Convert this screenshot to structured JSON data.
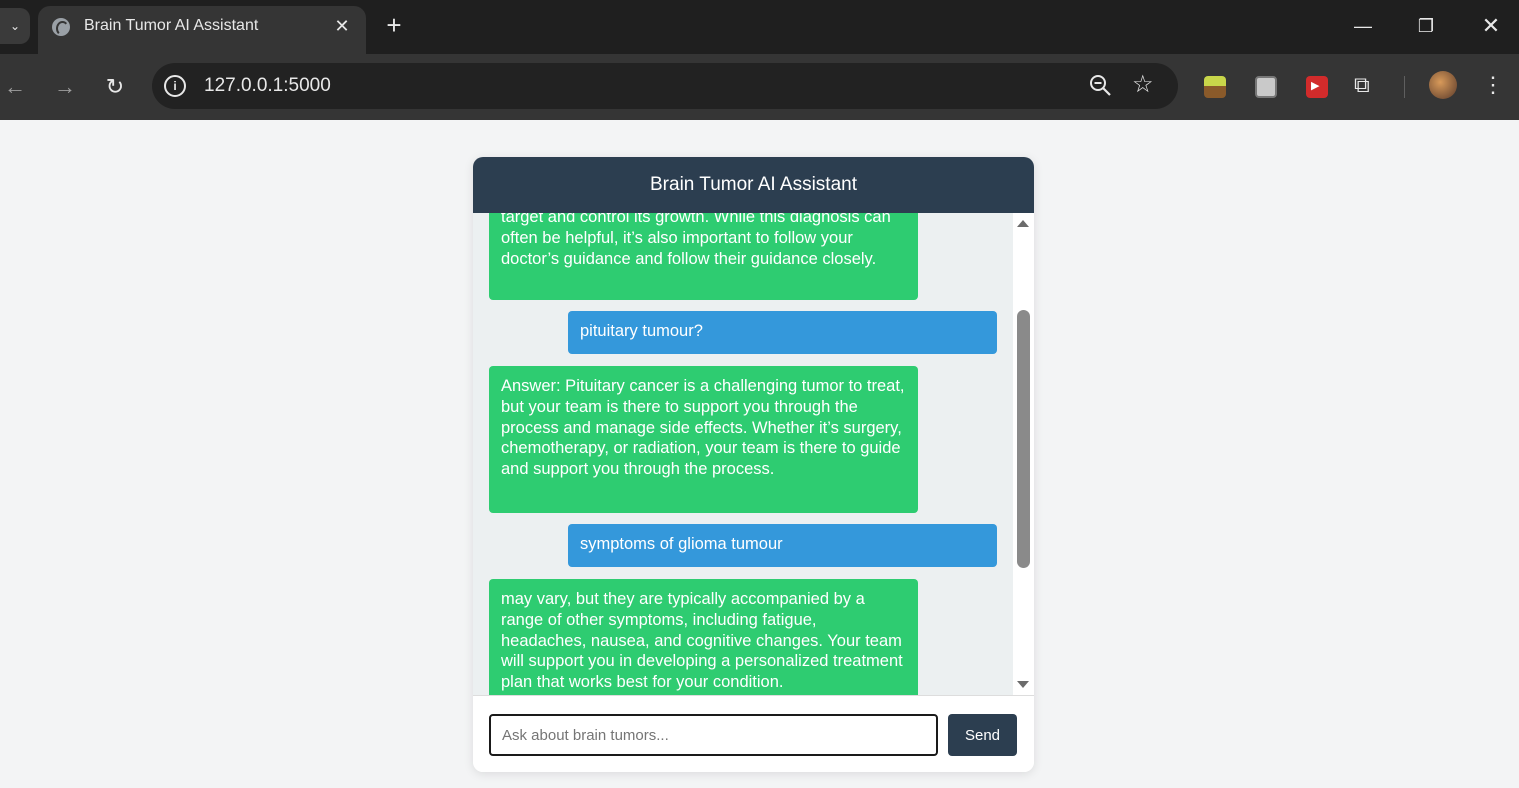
{
  "browser": {
    "tab_title": "Brain Tumor AI Assistant",
    "url": "127.0.0.1:5000",
    "icons": [
      "tab-search-icon",
      "globe-icon",
      "close-icon",
      "plus-icon",
      "minimize-icon",
      "restore-icon",
      "window-close-icon",
      "back-icon",
      "forward-icon",
      "reload-icon",
      "info-icon",
      "zoom-icon",
      "star-icon",
      "extension-icon",
      "puzzle-icon",
      "avatar",
      "kebab-menu-icon"
    ]
  },
  "chat": {
    "header_title": "Brain Tumor AI Assistant",
    "messages": [
      {
        "role": "bot",
        "text": "target and control its growth. While this diagnosis can often be helpful, it’s also important to follow your doctor’s guidance and follow their guidance closely."
      },
      {
        "role": "user",
        "text": "pituitary tumour?"
      },
      {
        "role": "bot",
        "text": "Answer: Pituitary cancer is a challenging tumor to treat, but your team is there to support you through the process and manage side effects. Whether it’s surgery, chemotherapy, or radiation, your team is there to guide and support you through the process."
      },
      {
        "role": "user",
        "text": "symptoms of glioma tumour"
      },
      {
        "role": "bot",
        "text": "may vary, but they are typically accompanied by a range of other symptoms, including fatigue, headaches, nausea, and cognitive changes. Your team will support you in developing a personalized treatment plan that works best for your condition."
      }
    ],
    "input_placeholder": "Ask about brain tumors...",
    "input_value": "",
    "send_label": "Send"
  },
  "colors": {
    "header": "#2c3e50",
    "bot_bubble": "#2ecc71",
    "user_bubble": "#3498db",
    "messages_bg": "#ecf0f1",
    "send_button": "#2c3e50"
  }
}
